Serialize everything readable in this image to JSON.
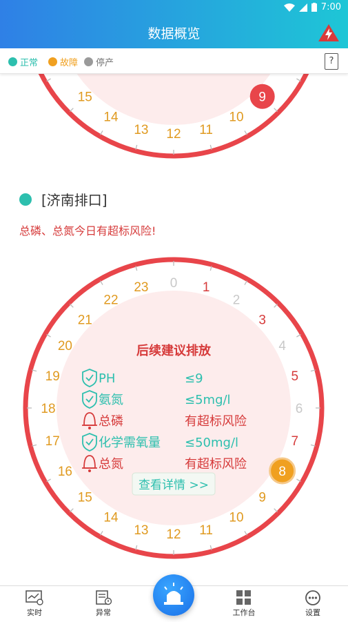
{
  "status": {
    "time": "7:00"
  },
  "header": {
    "title": "数据概览"
  },
  "legend": [
    {
      "label": "正常",
      "color": "#2dbfae"
    },
    {
      "label": "故障",
      "color": "#f0a020"
    },
    {
      "label": "停产",
      "color": "#9a9a9a"
    }
  ],
  "help_label": "?",
  "top_dial": {
    "hours": [
      "15",
      "14",
      "13",
      "12",
      "11",
      "10"
    ],
    "highlight": "9"
  },
  "station": {
    "name": "[济南排口]",
    "warning": "总磷、总氮今日有超标风险!"
  },
  "dial": {
    "hours": [
      {
        "h": "0",
        "c": "#c8c8c8"
      },
      {
        "h": "1",
        "c": "#d63b3b"
      },
      {
        "h": "2",
        "c": "#c8c8c8"
      },
      {
        "h": "3",
        "c": "#d63b3b"
      },
      {
        "h": "4",
        "c": "#c8c8c8"
      },
      {
        "h": "5",
        "c": "#d63b3b"
      },
      {
        "h": "6",
        "c": "#c8c8c8"
      },
      {
        "h": "7",
        "c": "#d63b3b"
      },
      {
        "h": "8",
        "c": "#ffffff"
      },
      {
        "h": "9",
        "c": "#e09a20"
      },
      {
        "h": "10",
        "c": "#e09a20"
      },
      {
        "h": "11",
        "c": "#e09a20"
      },
      {
        "h": "12",
        "c": "#e09a20"
      },
      {
        "h": "13",
        "c": "#e09a20"
      },
      {
        "h": "14",
        "c": "#e09a20"
      },
      {
        "h": "15",
        "c": "#e09a20"
      },
      {
        "h": "16",
        "c": "#e09a20"
      },
      {
        "h": "17",
        "c": "#e09a20"
      },
      {
        "h": "18",
        "c": "#e09a20"
      },
      {
        "h": "19",
        "c": "#e09a20"
      },
      {
        "h": "20",
        "c": "#e09a20"
      },
      {
        "h": "21",
        "c": "#e09a20"
      },
      {
        "h": "22",
        "c": "#e09a20"
      },
      {
        "h": "23",
        "c": "#e09a20"
      }
    ],
    "current_hour": "8",
    "title": "后续建议排放",
    "rows": [
      {
        "name": "PH",
        "value": "≤9",
        "status": "normal"
      },
      {
        "name": "氨氮",
        "value": "≤5mg/l",
        "status": "normal"
      },
      {
        "name": "总磷",
        "value": "有超标风险",
        "status": "alert"
      },
      {
        "name": "化学需氧量",
        "value": "≤50mg/l",
        "status": "normal"
      },
      {
        "name": "总氮",
        "value": "有超标风险",
        "status": "alert"
      }
    ],
    "details_label": "查看详情 >>"
  },
  "colors": {
    "normal": "#2dbfae",
    "alert": "#d63b3b",
    "ring": "#e8454a",
    "fill": "#fdecec"
  },
  "tabs": [
    {
      "label": "实时",
      "icon": "monitor-icon"
    },
    {
      "label": "异常",
      "icon": "document-alert-icon"
    },
    {
      "label": "工作台",
      "icon": "grid-icon"
    },
    {
      "label": "设置",
      "icon": "chat-bubble-icon"
    }
  ]
}
